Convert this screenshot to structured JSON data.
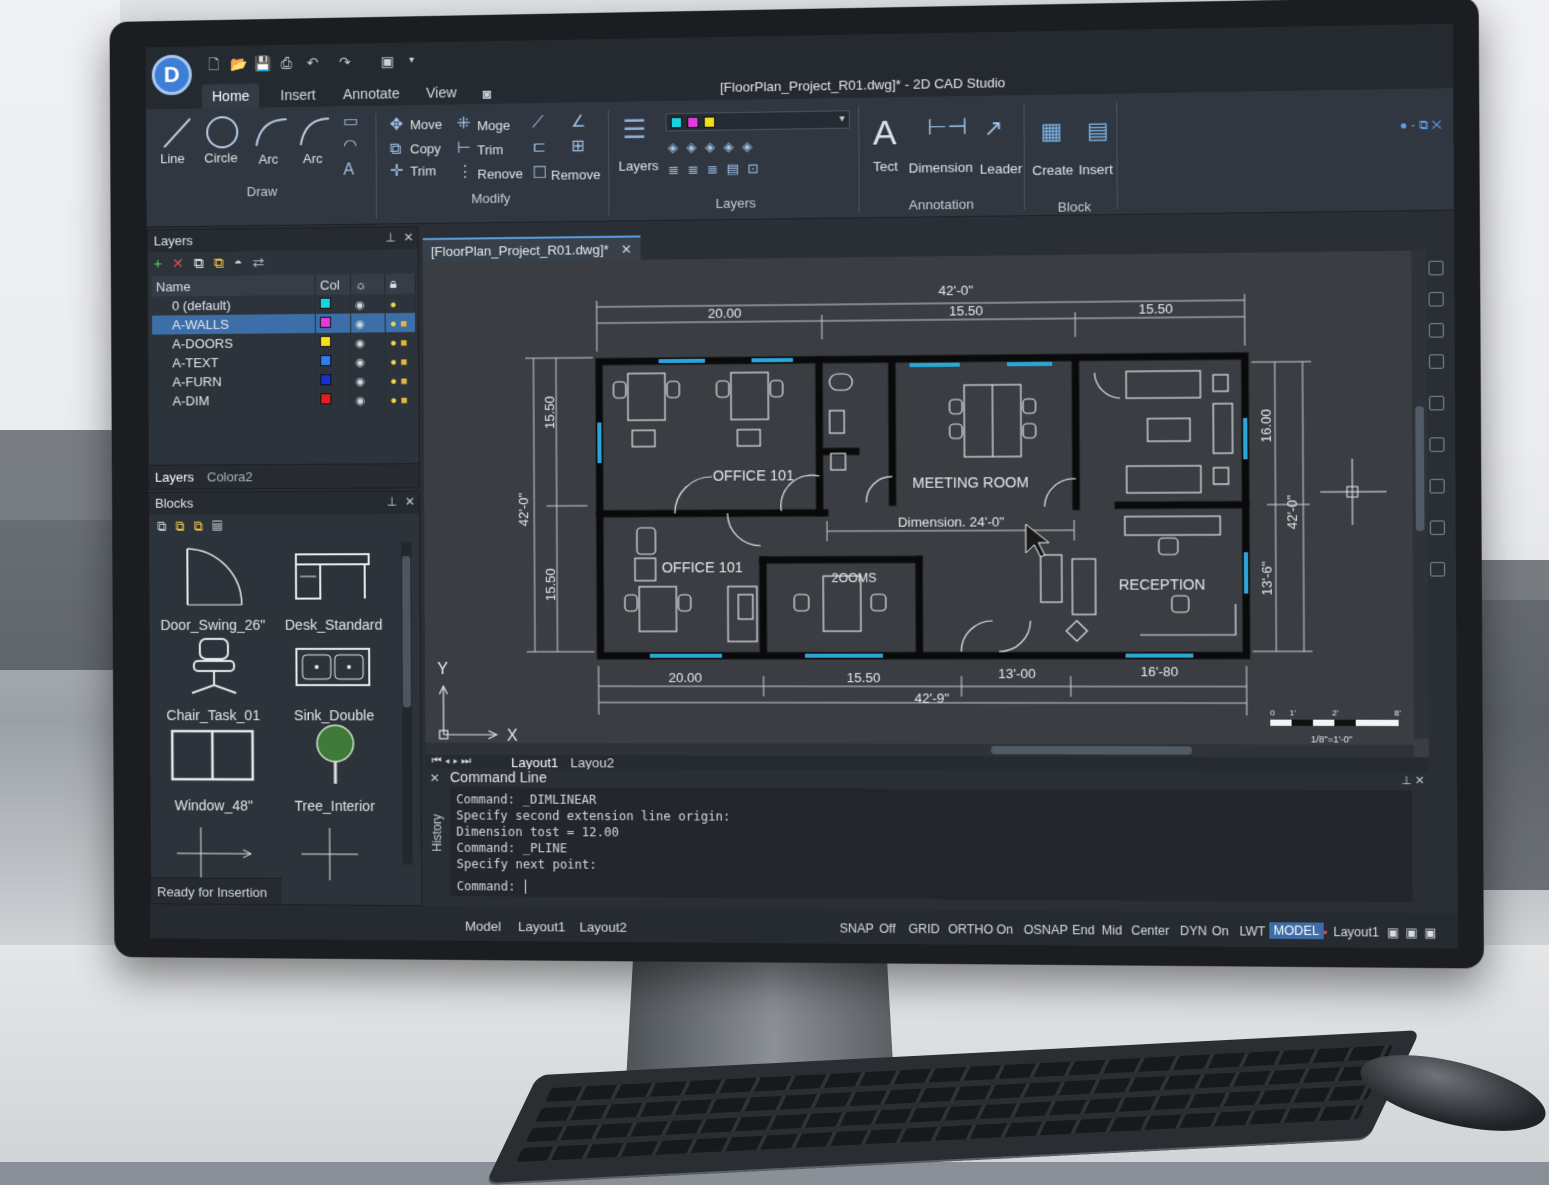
{
  "app": {
    "title": "[FloorPlan_Project_R01.dwg]* - 2D CAD Studio",
    "logo_letter": "D",
    "tabs": [
      "Home",
      "Insert",
      "Annotate",
      "View"
    ],
    "active_tab": "Home"
  },
  "ribbon": {
    "draw": {
      "label": "Draw",
      "tools": [
        "Line",
        "Circle",
        "Arc",
        "Arc"
      ]
    },
    "modify": {
      "label": "Modify",
      "tools": [
        "Move",
        "Moge",
        "Copy",
        "Trim",
        "Trim",
        "Renove",
        "Remove"
      ]
    },
    "layers": {
      "label": "Layers",
      "button": "Layers"
    },
    "annotation": {
      "label": "Annotation",
      "tools": [
        "Tect",
        "Dimension",
        "Leader"
      ]
    },
    "block": {
      "label": "Block",
      "tools": [
        "Create",
        "Insert"
      ]
    }
  },
  "layers_panel": {
    "title": "Layers",
    "columns": [
      "Name",
      "Col"
    ],
    "rows": [
      {
        "name": "0 (default)",
        "color": "#19d3e0"
      },
      {
        "name": "A-WALLS",
        "color": "#e23ce0"
      },
      {
        "name": "A-DOORS",
        "color": "#f2e01c"
      },
      {
        "name": "A-TEXT",
        "color": "#2f7df0"
      },
      {
        "name": "A-FURN",
        "color": "#1530d8"
      },
      {
        "name": "A-DIM",
        "color": "#e21f1f"
      }
    ],
    "selected": "A-WALLS",
    "bottom_tabs": [
      "Layers",
      "Colora2"
    ]
  },
  "blocks_panel": {
    "title": "Blocks",
    "items": [
      "Door_Swing_26\"",
      "Desk_Standard",
      "Chair_Task_01",
      "Sink_Double",
      "Window_48\"",
      "Tree_Interior"
    ],
    "status": "Ready for Insertion"
  },
  "document": {
    "tab": "[FloorPlan_Project_R01.dwg]*",
    "rooms": [
      "OFFICE 101",
      "MEETING ROOM",
      "OFFICE 101",
      "RECEPTION",
      "2OOMS"
    ],
    "dimension_note": "Dimension. 24'-0\"",
    "dims_top": [
      "42'-0\"",
      "20.00",
      "15.50",
      "15.50"
    ],
    "dims_bottom": [
      "20.00",
      "15.50",
      "13'-00",
      "16'-80",
      "42'-9\""
    ],
    "dims_left": [
      "15.50",
      "42'-0\"",
      "15.50"
    ],
    "dims_right": [
      "16.00",
      "42'-0\"",
      "13'-6\""
    ],
    "axis_x": "X",
    "axis_y": "Y",
    "scale_label": "1/8\"=1'-0\"",
    "scale_ticks": [
      "0",
      "1'",
      "2'",
      "8'"
    ],
    "layout_tabs": [
      "Layout1",
      "Layou2"
    ]
  },
  "command_line": {
    "title": "Command Line",
    "side_label": "History",
    "lines": [
      "Command: _DIMLINEAR",
      "Specify second extension line origin:",
      "Dimension tost = 12.00",
      "Command: _PLINE",
      "Specify next point:"
    ],
    "prompt": "Command:"
  },
  "status_bar": {
    "tabs": [
      "Model",
      "Layout1",
      "Layout2"
    ],
    "items": [
      "SNAP",
      "Off",
      "GRID",
      "ORTHO",
      "On",
      "OSNAP",
      "End",
      "Mid",
      "Center",
      "DYN",
      "On",
      "LWT"
    ],
    "model": "MODEL",
    "layout": "Layout1"
  }
}
